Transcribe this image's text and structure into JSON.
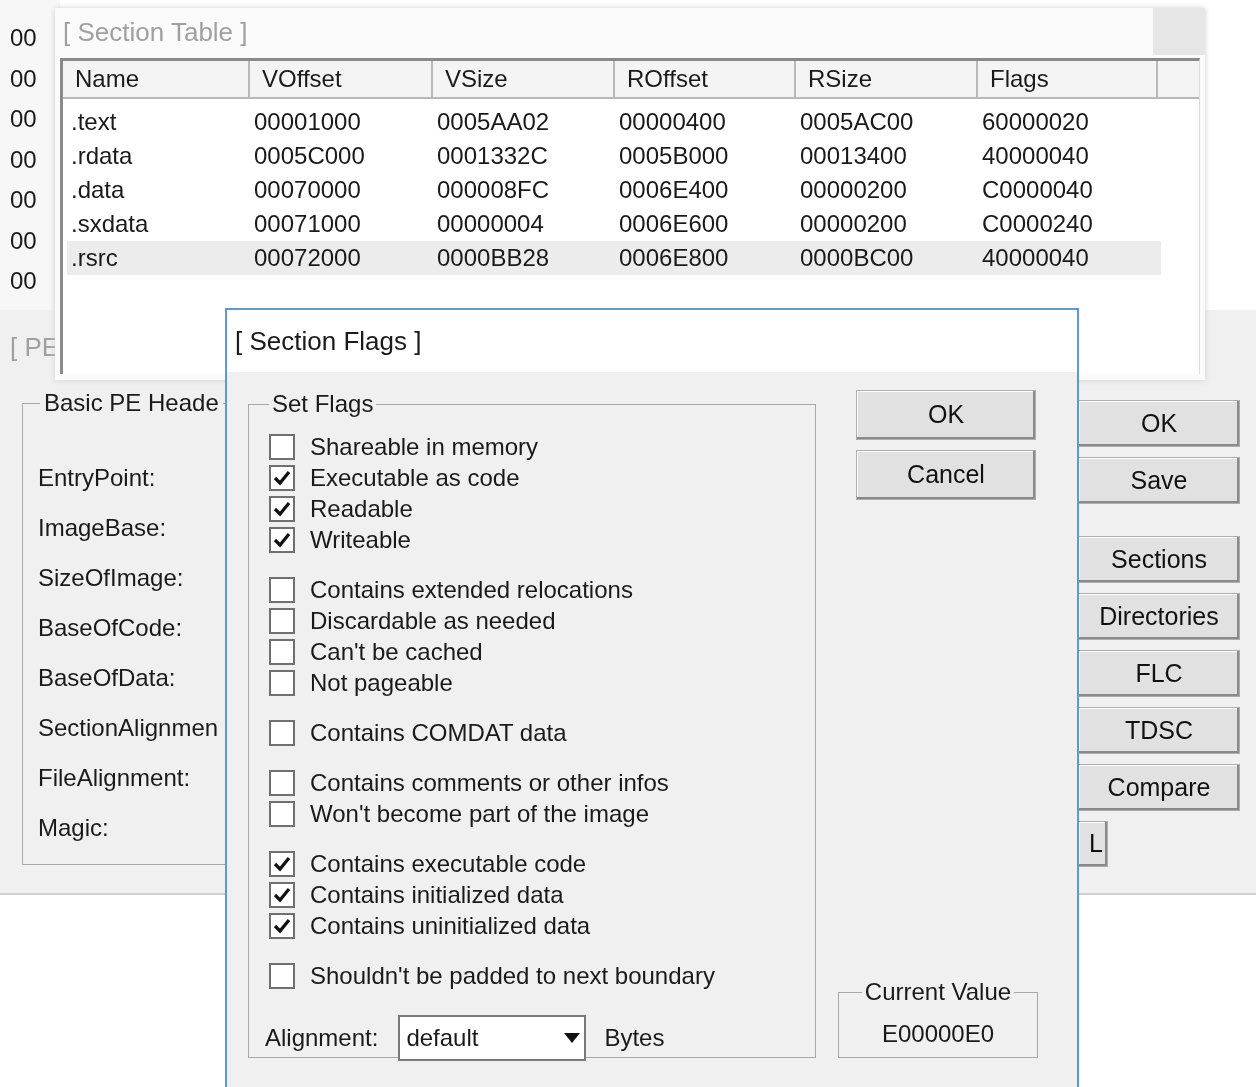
{
  "background_window": {
    "column_values": [
      "00",
      "00",
      "00",
      "00",
      "00",
      "00",
      "00"
    ]
  },
  "pe_editor": {
    "title": "[ PE",
    "group_title": "Basic PE Heade",
    "fields": [
      "EntryPoint:",
      "ImageBase:",
      "SizeOfImage:",
      "BaseOfCode:",
      "BaseOfData:",
      "SectionAlignmen",
      "FileAlignment:",
      "Magic:"
    ],
    "buttons": [
      {
        "label": "OK",
        "kind": "button"
      },
      {
        "label": "Save",
        "kind": "button"
      },
      {
        "label": "Sections",
        "kind": "spaced"
      },
      {
        "label": "Directories",
        "kind": "button"
      },
      {
        "label": "FLC",
        "kind": "button"
      },
      {
        "label": "TDSC",
        "kind": "button"
      },
      {
        "label": "Compare",
        "kind": "button"
      }
    ],
    "partial_button": "L"
  },
  "section_table": {
    "title": "[ Section Table ]",
    "columns": [
      "Name",
      "VOffset",
      "VSize",
      "ROffset",
      "RSize",
      "Flags"
    ],
    "rows": [
      {
        "cells": [
          ".text",
          "00001000",
          "0005AA02",
          "00000400",
          "0005AC00",
          "60000020"
        ],
        "selected": false
      },
      {
        "cells": [
          ".rdata",
          "0005C000",
          "0001332C",
          "0005B000",
          "00013400",
          "40000040"
        ],
        "selected": false
      },
      {
        "cells": [
          ".data",
          "00070000",
          "000008FC",
          "0006E400",
          "00000200",
          "C0000040"
        ],
        "selected": false
      },
      {
        "cells": [
          ".sxdata",
          "00071000",
          "00000004",
          "0006E600",
          "00000200",
          "C0000240"
        ],
        "selected": false
      },
      {
        "cells": [
          ".rsrc",
          "00072000",
          "0000BB28",
          "0006E800",
          "0000BC00",
          "40000040"
        ],
        "selected": true
      }
    ]
  },
  "section_flags": {
    "title": "[ Section Flags ]",
    "group_title": "Set Flags",
    "flag_groups": [
      [
        {
          "label": "Shareable in memory",
          "checked": false
        },
        {
          "label": "Executable as code",
          "checked": true
        },
        {
          "label": "Readable",
          "checked": true
        },
        {
          "label": "Writeable",
          "checked": true
        }
      ],
      [
        {
          "label": "Contains extended relocations",
          "checked": false
        },
        {
          "label": "Discardable as needed",
          "checked": false
        },
        {
          "label": "Can't be cached",
          "checked": false
        },
        {
          "label": "Not pageable",
          "checked": false
        }
      ],
      [
        {
          "label": "Contains COMDAT data",
          "checked": false
        }
      ],
      [
        {
          "label": "Contains comments or other infos",
          "checked": false
        },
        {
          "label": "Won't become part of the image",
          "checked": false
        }
      ],
      [
        {
          "label": "Contains executable code",
          "checked": true
        },
        {
          "label": "Contains initialized data",
          "checked": true
        },
        {
          "label": "Contains uninitialized data",
          "checked": true
        }
      ],
      [
        {
          "label": "Shouldn't be padded to next boundary",
          "checked": false
        }
      ]
    ],
    "alignment": {
      "label": "Alignment:",
      "value": "default",
      "unit": "Bytes"
    },
    "buttons": [
      "OK",
      "Cancel"
    ],
    "current_value": {
      "title": "Current Value",
      "value": "E00000E0"
    }
  }
}
